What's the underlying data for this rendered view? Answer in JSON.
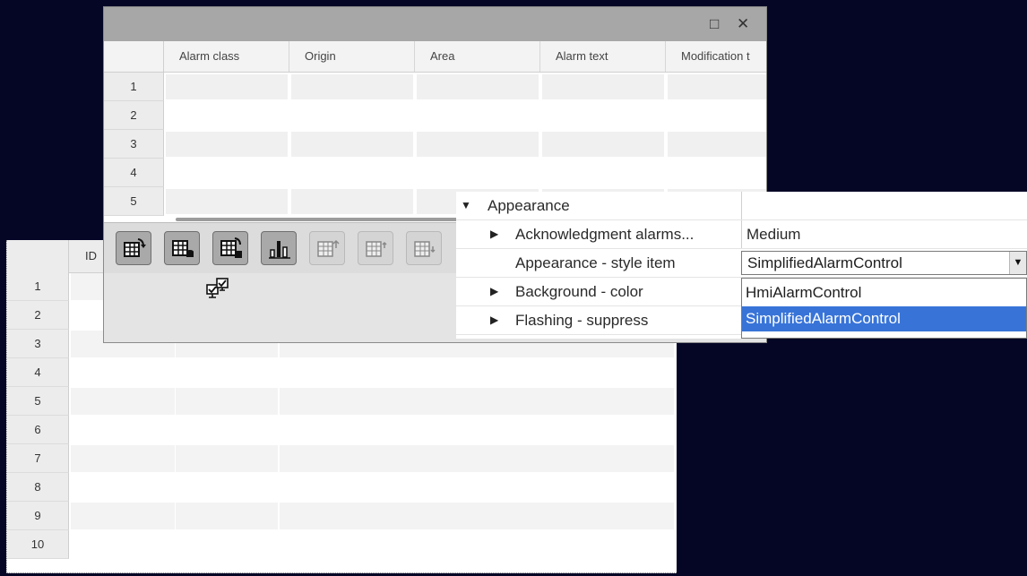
{
  "back_control": {
    "columns": [
      "ID"
    ],
    "row_numbers": [
      "1",
      "2",
      "3",
      "4",
      "5",
      "6",
      "7",
      "8",
      "9",
      "10"
    ]
  },
  "front_window": {
    "title_buttons": {
      "maximize": "□",
      "close": "✕"
    },
    "columns": [
      "Alarm class",
      "Origin",
      "Area",
      "Alarm text",
      "Modification t"
    ],
    "row_numbers": [
      "1",
      "2",
      "3",
      "4",
      "5"
    ],
    "toolbar_buttons": [
      {
        "name": "current-alarms-icon",
        "state": "enabled"
      },
      {
        "name": "alarm-log-icon",
        "state": "enabled"
      },
      {
        "name": "log-sequence-icon",
        "state": "enabled"
      },
      {
        "name": "alarm-statistics-icon",
        "state": "enabled"
      },
      {
        "name": "select-first-row-icon",
        "state": "disabled"
      },
      {
        "name": "select-previous-row-icon",
        "state": "disabled"
      },
      {
        "name": "select-next-row-icon",
        "state": "disabled"
      }
    ],
    "status_icon": "multi-acknowledge-icon"
  },
  "properties": {
    "section": "Appearance",
    "rows": [
      {
        "label": "Acknowledgment alarms...",
        "value": "Medium",
        "expandable": true
      },
      {
        "label": "Appearance - style item",
        "value": "SimplifiedAlarmControl",
        "expandable": false
      },
      {
        "label": "Background - color",
        "value": "",
        "expandable": true
      },
      {
        "label": "Flashing - suppress",
        "value": "",
        "expandable": true
      }
    ],
    "dropdown_options": [
      "HmiAlarmControl",
      "SimplifiedAlarmControl"
    ],
    "selected_option": "SimplifiedAlarmControl",
    "colors": {
      "selection": "#3874d8"
    }
  }
}
